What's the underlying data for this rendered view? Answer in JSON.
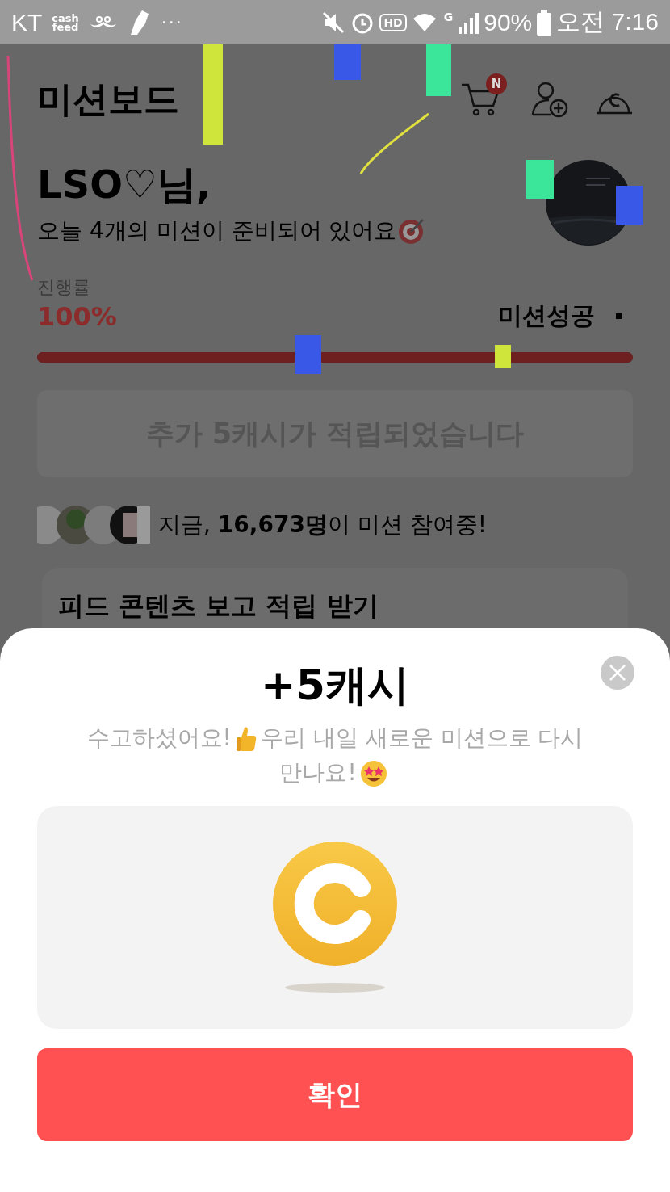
{
  "status_bar": {
    "carrier": "KT",
    "logo_top": "cash",
    "logo_bottom": "feed",
    "more": "···",
    "hd": "HD",
    "network": "G",
    "battery": "90%",
    "time": "오전 7:16"
  },
  "header": {
    "title": "미션보드",
    "cart_badge": "N"
  },
  "greeting": {
    "name": "LSO♡님,",
    "subtitle": "오늘 4개의 미션이 준비되어 있어요"
  },
  "progress": {
    "label": "진행률",
    "percent": "100%",
    "status": "미션성공",
    "level": 1
  },
  "notice": "추가 5캐시가 적립되었습니다",
  "participants": "지금, **16,673명**이 미션 참여중!",
  "card": {
    "title": "피드 콘텐츠 보고 적립 받기"
  },
  "sheet": {
    "title": "+5캐시",
    "message_1": "수고하셨어요!",
    "message_2": "우리 내일 새로운 미션으로 다시",
    "message_3": "만나요!",
    "button": "확인"
  }
}
